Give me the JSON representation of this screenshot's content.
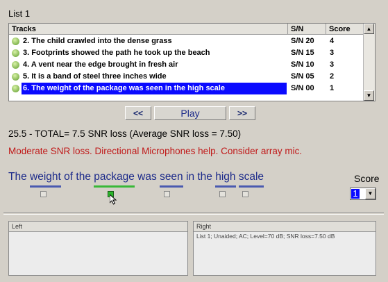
{
  "list_title": "List 1",
  "table": {
    "headers": [
      "Tracks",
      "S/N",
      "Score"
    ],
    "rows": [
      {
        "track": "2. The child crawled into the dense grass",
        "sn": "S/N 20",
        "score": "4"
      },
      {
        "track": "3. Footprints showed the path he took up the beach",
        "sn": "S/N 15",
        "score": "3"
      },
      {
        "track": "4. A vent near the edge brought in fresh air",
        "sn": "S/N 10",
        "score": "3"
      },
      {
        "track": "5. It is a band of steel three inches wide",
        "sn": "S/N 05",
        "score": "2"
      },
      {
        "track": "6. The weight of the package was seen in the high scale",
        "sn": "S/N 00",
        "score": "1"
      }
    ],
    "scroll_up": "▲",
    "scroll_down": "▼"
  },
  "controls": {
    "prev": "<<",
    "play": "Play",
    "next": ">>"
  },
  "total_text": "25.5 - TOTAL= 7.5 SNR loss (Average SNR loss = 7.50)",
  "advice_text": "Moderate SNR loss. Directional Microphones help. Consider array mic.",
  "sentence": {
    "w1": "The",
    "w2": "weight",
    "w3": "of the",
    "w4": "package",
    "w5": "was",
    "w6": "seen",
    "w7": "in the",
    "w8": "high",
    "w9": "scale",
    "checked_index": 1
  },
  "score": {
    "label": "Score",
    "value": "1",
    "arrow": "▼"
  },
  "panes": {
    "left_title": "Left",
    "right_title": "Right",
    "right_text": "List 1; Unaided; AC; Level=70 dB; SNR loss=7.50 dB"
  },
  "colors": {
    "selection": "#0a0aff",
    "advice": "#c01818",
    "keyword_underline": "#4a5ab0",
    "checked": "#2bb62b"
  }
}
